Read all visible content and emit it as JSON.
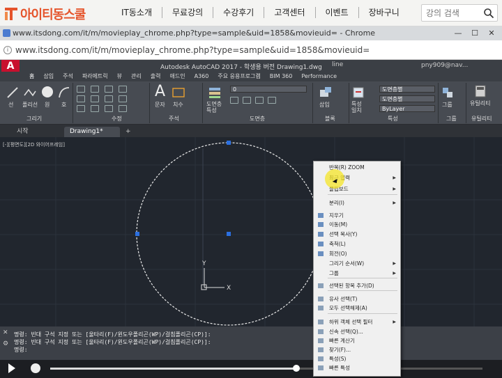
{
  "site": {
    "logo_text": "아이티동스쿨",
    "nav": [
      "IT동소개",
      "무료강의",
      "수강후기",
      "고객센터",
      "이벤트",
      "장바구니"
    ],
    "search_placeholder": "강의 검색"
  },
  "browser": {
    "title": "www.itsdong.com/it/m/movieplay_chrome.php?type=sample&uid=1858&movieuid= - Chrome",
    "url": "www.itsdong.com/it/m/movieplay_chrome.php?type=sample&uid=1858&movieuid=",
    "minimize": "—",
    "maximize": "☐",
    "close": "✕"
  },
  "autocad": {
    "logo": "A",
    "title": "Autodesk AutoCAD 2017 - 학생용 버전    Drawing1.dwg",
    "search_hint": "line",
    "user": "pny909@nav...",
    "ribbon_tabs": [
      "홈",
      "삽입",
      "주석",
      "파라메트릭",
      "뷰",
      "관리",
      "출력",
      "애드인",
      "A360",
      "주요 응용프로그램",
      "BIM 360",
      "Performance"
    ],
    "panels": [
      "그리기",
      "수정",
      "주석",
      "도면층",
      "블록",
      "특성",
      "그룹",
      "유틸리티"
    ],
    "tools": {
      "line": "선",
      "polyline": "폴리선",
      "circle": "원",
      "arc": "호",
      "text": "문자",
      "dimension": "치수",
      "layer_props": "도면층 특성",
      "insert": "삽입",
      "match_props": "특성 일치",
      "group": "그룹",
      "utilities": "유틸리티"
    },
    "layer_combo": "0",
    "prop_combo_1": "도면층별",
    "prop_combo_2": "도면층별",
    "prop_combo_3": "ByLayer",
    "doc_tabs": [
      "시작",
      "Drawing1*",
      "+"
    ],
    "view_label": "[-][평면도][2D 와이어프레임]",
    "ucs_y": "Y",
    "ucs_x": "X"
  },
  "command": {
    "lines": [
      "명령: 빈대 구석 지정 또는 [울타리(F)/윈도우폴리곤(WP)/걸침폴리곤(CP)]:",
      "명령: 빈대 구석 지정 또는 [울타리(F)/윈도우폴리곤(WP)/걸침폴리곤(CP)]:",
      "명령:"
    ],
    "close_glyph": "✕",
    "settings_glyph": "🔧"
  },
  "player": {
    "progress": 0.57
  },
  "context_menu": {
    "items": [
      {
        "label": "반복(R) ZOOM",
        "submenu": false
      },
      {
        "label": "최근 입력",
        "submenu": true
      },
      {
        "label": "클립보드",
        "submenu": true
      },
      {
        "label": "분리(I)",
        "submenu": true
      },
      {
        "label": "지우기",
        "submenu": false
      },
      {
        "label": "이동(M)",
        "submenu": false
      },
      {
        "label": "선택 복사(Y)",
        "submenu": false
      },
      {
        "label": "축척(L)",
        "submenu": false
      },
      {
        "label": "회전(O)",
        "submenu": false
      },
      {
        "label": "그리기 순서(W)",
        "submenu": true
      },
      {
        "label": "그룹",
        "submenu": true
      },
      {
        "label": "선택된 항목 추가(D)",
        "submenu": false
      },
      {
        "label": "유사 선택(T)",
        "submenu": false
      },
      {
        "label": "모두 선택해제(A)",
        "submenu": false
      },
      {
        "label": "하위 객체 선택 필터",
        "submenu": true
      },
      {
        "label": "신속 선택(Q)...",
        "submenu": false
      },
      {
        "label": "빠른 계산기",
        "submenu": false
      },
      {
        "label": "찾기(F)...",
        "submenu": false
      },
      {
        "label": "특성(S)",
        "submenu": false
      },
      {
        "label": "빠른 특성",
        "submenu": false
      }
    ]
  }
}
